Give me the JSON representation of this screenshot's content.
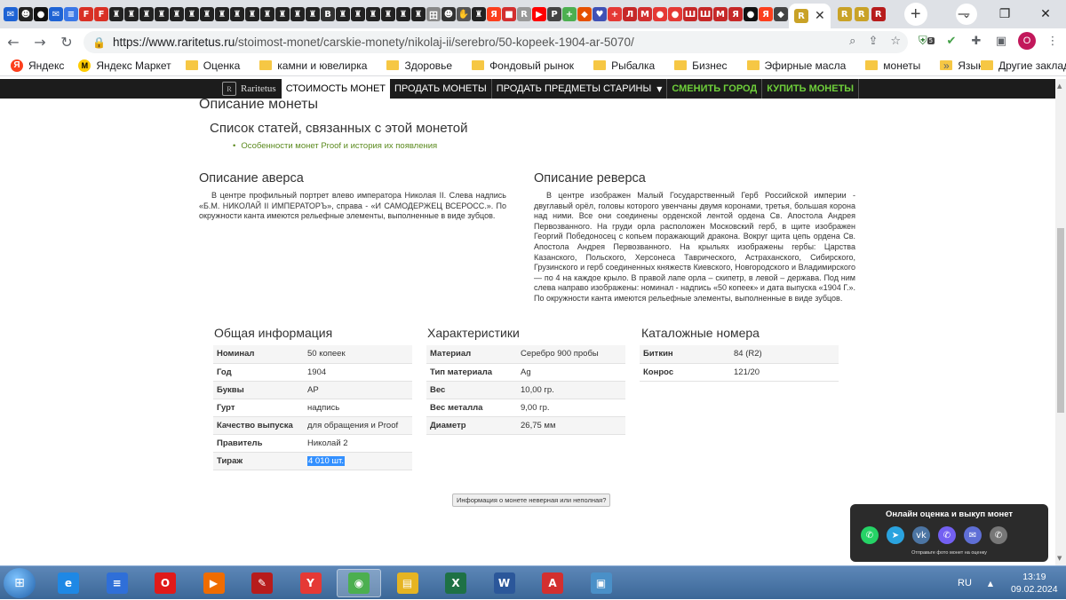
{
  "browser": {
    "tab_favicons": [
      {
        "glyph": "✉",
        "color": "#1e63d4"
      },
      {
        "glyph": "☻",
        "color": "#222"
      },
      {
        "glyph": "●",
        "color": "#111"
      },
      {
        "glyph": "✉",
        "color": "#1e63d4"
      },
      {
        "glyph": "≡",
        "color": "#3b78e7"
      },
      {
        "glyph": "F",
        "color": "#d93025"
      },
      {
        "glyph": "F",
        "color": "#d93025"
      },
      {
        "glyph": "♜",
        "color": "#222"
      },
      {
        "glyph": "♜",
        "color": "#222"
      },
      {
        "glyph": "♜",
        "color": "#222"
      },
      {
        "glyph": "♜",
        "color": "#222"
      },
      {
        "glyph": "♜",
        "color": "#222"
      },
      {
        "glyph": "♜",
        "color": "#222"
      },
      {
        "glyph": "♜",
        "color": "#222"
      },
      {
        "glyph": "♜",
        "color": "#222"
      },
      {
        "glyph": "♜",
        "color": "#222"
      },
      {
        "glyph": "♜",
        "color": "#222"
      },
      {
        "glyph": "♜",
        "color": "#222"
      },
      {
        "glyph": "♜",
        "color": "#222"
      },
      {
        "glyph": "♜",
        "color": "#222"
      },
      {
        "glyph": "♜",
        "color": "#222"
      },
      {
        "glyph": "B",
        "color": "#333"
      },
      {
        "glyph": "♜",
        "color": "#222"
      },
      {
        "glyph": "♜",
        "color": "#222"
      },
      {
        "glyph": "♜",
        "color": "#222"
      },
      {
        "glyph": "♜",
        "color": "#222"
      },
      {
        "glyph": "♜",
        "color": "#222"
      },
      {
        "glyph": "♜",
        "color": "#222"
      },
      {
        "glyph": "田",
        "color": "#888"
      },
      {
        "glyph": "☻",
        "color": "#333"
      },
      {
        "glyph": "✋",
        "color": "#555"
      },
      {
        "glyph": "♜",
        "color": "#222"
      },
      {
        "glyph": "Я",
        "color": "#fc3f1d"
      },
      {
        "glyph": "■",
        "color": "#d32f2f"
      },
      {
        "glyph": "R",
        "color": "#999"
      },
      {
        "glyph": "▶",
        "color": "#ff0000"
      },
      {
        "glyph": "P",
        "color": "#444"
      },
      {
        "glyph": "+",
        "color": "#4caf50"
      },
      {
        "glyph": "◆",
        "color": "#e65100"
      },
      {
        "glyph": "♥",
        "color": "#3f51b5"
      },
      {
        "glyph": "+",
        "color": "#e53935"
      },
      {
        "glyph": "Л",
        "color": "#c62828"
      },
      {
        "glyph": "M",
        "color": "#d32f2f"
      },
      {
        "glyph": "●",
        "color": "#e53935"
      },
      {
        "glyph": "●",
        "color": "#e53935"
      },
      {
        "glyph": "Ш",
        "color": "#c62828"
      },
      {
        "glyph": "Ш",
        "color": "#c62828"
      },
      {
        "glyph": "M",
        "color": "#c62828"
      },
      {
        "glyph": "Я",
        "color": "#c62828"
      },
      {
        "glyph": "●",
        "color": "#111"
      },
      {
        "glyph": "Я",
        "color": "#fc3f1d"
      },
      {
        "glyph": "◆",
        "color": "#444"
      }
    ],
    "active_tab_favicon": {
      "glyph": "R",
      "color": "#c9a227"
    },
    "extra_tab_favicons": [
      {
        "glyph": "R",
        "color": "#c9a227"
      },
      {
        "glyph": "R",
        "color": "#c9a227"
      },
      {
        "glyph": "R",
        "color": "#b71c1c"
      }
    ],
    "url_host": "https://www.raritetus.ru",
    "url_path": "/stoimost-monet/carskie-monety/nikolaj-ii/serebro/50-kopeek-1904-ar-5070/",
    "extension_badge": "5",
    "profile_letter": "O",
    "bookmarks": [
      {
        "label": "Яндекс",
        "icon": "yandex"
      },
      {
        "label": "Яндекс Маркет",
        "icon": "market"
      },
      {
        "label": "Оценка",
        "icon": "folder"
      },
      {
        "label": "камни и ювелирка",
        "icon": "folder"
      },
      {
        "label": "Здоровье",
        "icon": "folder"
      },
      {
        "label": "Фондовый рынок",
        "icon": "folder"
      },
      {
        "label": "Рыбалка",
        "icon": "folder"
      },
      {
        "label": "Бизнес",
        "icon": "folder"
      },
      {
        "label": "Эфирные масла",
        "icon": "folder"
      },
      {
        "label": "монеты",
        "icon": "folder"
      },
      {
        "label": "Язык",
        "icon": "folder"
      }
    ],
    "bookmarks_more": "»",
    "other_bookmarks": "Другие закладки"
  },
  "site": {
    "logo_text": "Raritetus",
    "nav": [
      {
        "label": "СТОИМОСТЬ МОНЕТ",
        "style": "active"
      },
      {
        "label": "ПРОДАТЬ МОНЕТЫ",
        "style": "normal"
      },
      {
        "label": "ПРОДАТЬ ПРЕДМЕТЫ СТАРИНЫ",
        "style": "dropdown"
      },
      {
        "label": "СМЕНИТЬ ГОРОД",
        "style": "green"
      },
      {
        "label": "КУПИТЬ МОНЕТЫ",
        "style": "green"
      }
    ]
  },
  "page": {
    "description_title": "Описание монеты",
    "articles_title": "Список статей, связанных с этой монетой",
    "article_link": "Особенности монет Proof и история их появления",
    "obverse_title": "Описание аверса",
    "obverse_text": "В центре профильный портрет влево императора Николая II. Слева надпись «Б.М. НИКОЛАЙ II ИМПЕРАТОРЪ», справа - «И САМОДЕРЖЕЦ ВСЕРОСС.». По окружности канта имеются рельефные элементы, выполненные в виде зубцов.",
    "reverse_title": "Описание реверса",
    "reverse_text": "В центре изображен Малый Государственный Герб Российской империи - двуглавый орёл, головы которого увенчаны двумя коронами, третья, большая корона над ними. Все они соединены орденской лентой ордена Св. Апостола Андрея Первозванного. На груди орла расположен Московский герб, в щите изображен Георгий Победоносец с копьем поражающий дракона. Вокруг щита цепь ордена Св. Апостола Андрея Первозванного. На крыльях изображены гербы: Царства Казанского, Польского, Херсонеса Таврического, Астраханского, Сибирского, Грузинского и герб соединенных княжеств Киевского, Новгородского и Владимирского — по 4 на каждое крыло. В правой лапе орла – скипетр, в левой – держава. Под ним слева направо изображены: номинал - надпись «50 копеек» и дата выпуска «1904 Г.». По окружности канта имеются рельефные элементы, выполненные в виде зубцов.",
    "general_title": "Общая информация",
    "general": [
      {
        "k": "Номинал",
        "v": "50 копеек"
      },
      {
        "k": "Год",
        "v": "1904"
      },
      {
        "k": "Буквы",
        "v": "АР"
      },
      {
        "k": "Гурт",
        "v": "надпись"
      },
      {
        "k": "Качество выпуска",
        "v": "для обращения и Proof"
      },
      {
        "k": "Правитель",
        "v": "Николай 2"
      },
      {
        "k": "Тираж",
        "v": "4 010 шт."
      }
    ],
    "specs_title": "Характеристики",
    "specs": [
      {
        "k": "Материал",
        "v": "Серебро 900 пробы"
      },
      {
        "k": "Тип материала",
        "v": "Ag"
      },
      {
        "k": "Вес",
        "v": "10,00 гр."
      },
      {
        "k": "Вес металла",
        "v": "9,00 гр."
      },
      {
        "k": "Диаметр",
        "v": "26,75 мм"
      }
    ],
    "catalog_title": "Каталожные номера",
    "catalog": [
      {
        "k": "Биткин",
        "v": "84 (R2)"
      },
      {
        "k": "Конрос",
        "v": "121/20"
      }
    ],
    "report_button": "Информация о монете неверная или неполная?"
  },
  "widget": {
    "title": "Онлайн оценка и выкуп монет",
    "subtitle": "Отправьте фото монет на оценку",
    "icons": [
      {
        "name": "whatsapp-icon",
        "glyph": "✆",
        "color": "#25d366"
      },
      {
        "name": "telegram-icon",
        "glyph": "➤",
        "color": "#2aa3df"
      },
      {
        "name": "vk-icon",
        "glyph": "vk",
        "color": "#4c75a3"
      },
      {
        "name": "viber-icon",
        "glyph": "✆",
        "color": "#7360f2"
      },
      {
        "name": "email-icon",
        "glyph": "✉",
        "color": "#5f6fd6"
      },
      {
        "name": "phone-icon",
        "glyph": "✆",
        "color": "#777777"
      }
    ]
  },
  "taskbar": {
    "apps": [
      {
        "name": "ie-icon",
        "glyph": "e",
        "color": "#1e88e5"
      },
      {
        "name": "document-icon",
        "glyph": "≡",
        "color": "#2f6fd8"
      },
      {
        "name": "opera-icon",
        "glyph": "O",
        "color": "#e01a1a"
      },
      {
        "name": "media-player-icon",
        "glyph": "▶",
        "color": "#ef6c00"
      },
      {
        "name": "paint-icon",
        "glyph": "✎",
        "color": "#b71c1c"
      },
      {
        "name": "yandex-browser-icon",
        "glyph": "Y",
        "color": "#e53935"
      },
      {
        "name": "chrome-icon",
        "glyph": "◉",
        "color": "#4caf50"
      },
      {
        "name": "file-explorer-icon",
        "glyph": "▤",
        "color": "#e6b422"
      },
      {
        "name": "excel-icon",
        "glyph": "X",
        "color": "#1e7145"
      },
      {
        "name": "word-icon",
        "glyph": "W",
        "color": "#2b579a"
      },
      {
        "name": "pdf-icon",
        "glyph": "A",
        "color": "#d32f2f"
      },
      {
        "name": "photo-viewer-icon",
        "glyph": "▣",
        "color": "#4a90c8"
      }
    ],
    "active_app": 6,
    "lang": "RU",
    "time": "13:19",
    "date": "09.02.2024"
  }
}
